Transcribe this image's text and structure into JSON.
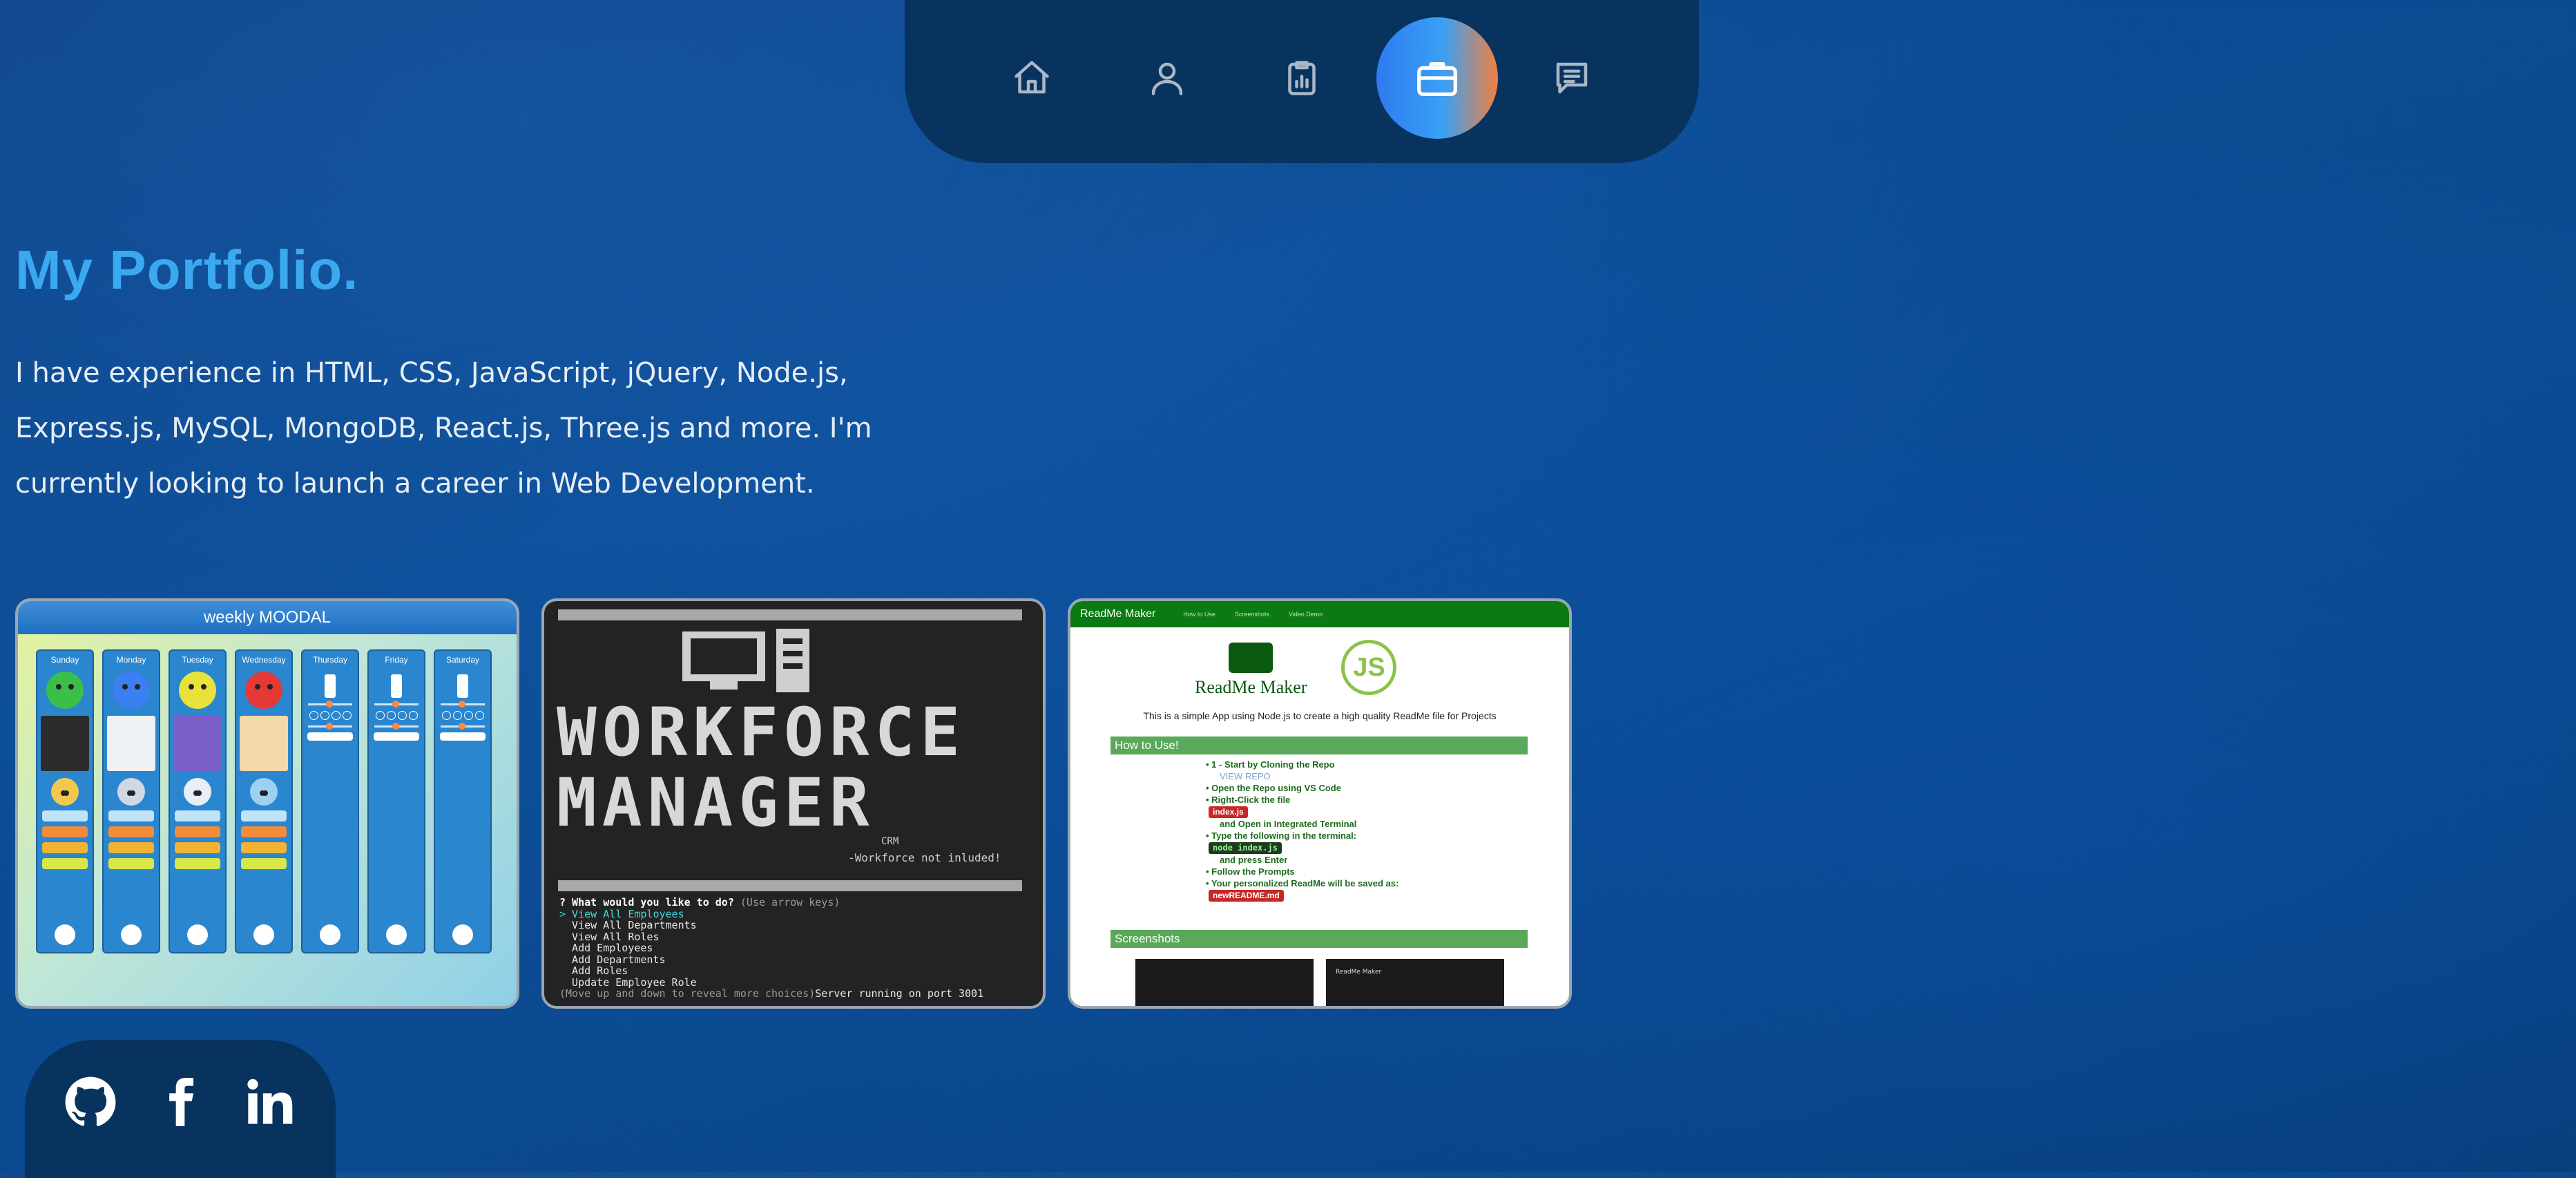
{
  "nav": {
    "items": [
      {
        "id": "home",
        "icon": "home-icon",
        "active": false
      },
      {
        "id": "about",
        "icon": "user-icon",
        "active": false
      },
      {
        "id": "skills",
        "icon": "clipboard-chart-icon",
        "active": false
      },
      {
        "id": "portfolio",
        "icon": "briefcase-icon",
        "active": true
      },
      {
        "id": "contact",
        "icon": "chat-icon",
        "active": false
      }
    ]
  },
  "portfolio": {
    "title": "My Portfolio.",
    "description": "I have experience in HTML, CSS, JavaScript, jQuery, Node.js, Express.js, MySQL, MongoDB, React.js, Three.js and more. I'm currently looking to launch a career in Web Development."
  },
  "projects": {
    "moodal": {
      "title": "weekly MOODAL",
      "days": [
        "Sunday",
        "Monday",
        "Tuesday",
        "Wednesday",
        "Thursday",
        "Friday",
        "Saturday"
      ]
    },
    "workforce": {
      "title_line1": "WORKFORCE",
      "title_line2": "MANAGER",
      "crm": "CRM",
      "note": "-Workforce not inluded!",
      "prompt": "? What would you like to do?",
      "prompt_hint": "(Use arrow keys)",
      "options": [
        "> View All Employees",
        "  View All Departments",
        "  View All Roles",
        "  Add Employees",
        "  Add Departments",
        "  Add Roles",
        "  Update Employee Role"
      ],
      "footer_hint": "(Move up and down to reveal more choices)",
      "footer_status": "Server running on port 3001"
    },
    "readme": {
      "header_title": "ReadMe Maker",
      "header_links": [
        "How to Use",
        "Screenshots",
        "Video Demo"
      ],
      "brand": "ReadMe Maker",
      "js_logo": "JS",
      "tagline": "This is a simple App using Node.js to create a high quality ReadMe file for Projects",
      "how_to_use": "How to Use!",
      "steps": {
        "s1": "1 - Start by Cloning the Repo",
        "s1_sub": "VIEW REPO",
        "s2": "Open the Repo using VS Code",
        "s3": "Right-Click the file",
        "s3_code": "index.js",
        "s3_b": "and Open in Integrated Terminal",
        "s4": "Type the following in the terminal:",
        "s4_code": "node index.js",
        "s4_b": "and press Enter",
        "s5": "Follow the Prompts",
        "s6": "Your personalized ReadMe will be saved as:",
        "s6_code": "newREADME.md"
      },
      "screenshots": "Screenshots",
      "shot2_title": "ReadMe Maker"
    }
  },
  "social": [
    {
      "id": "github",
      "icon": "github-icon"
    },
    {
      "id": "facebook",
      "icon": "facebook-icon"
    },
    {
      "id": "linkedin",
      "icon": "linkedin-icon"
    }
  ],
  "colors": {
    "accent": "#3aa9f0",
    "nav_bg": "#08335f",
    "active_gradient_start": "#2f7bf0",
    "active_gradient_end": "#f08040"
  }
}
